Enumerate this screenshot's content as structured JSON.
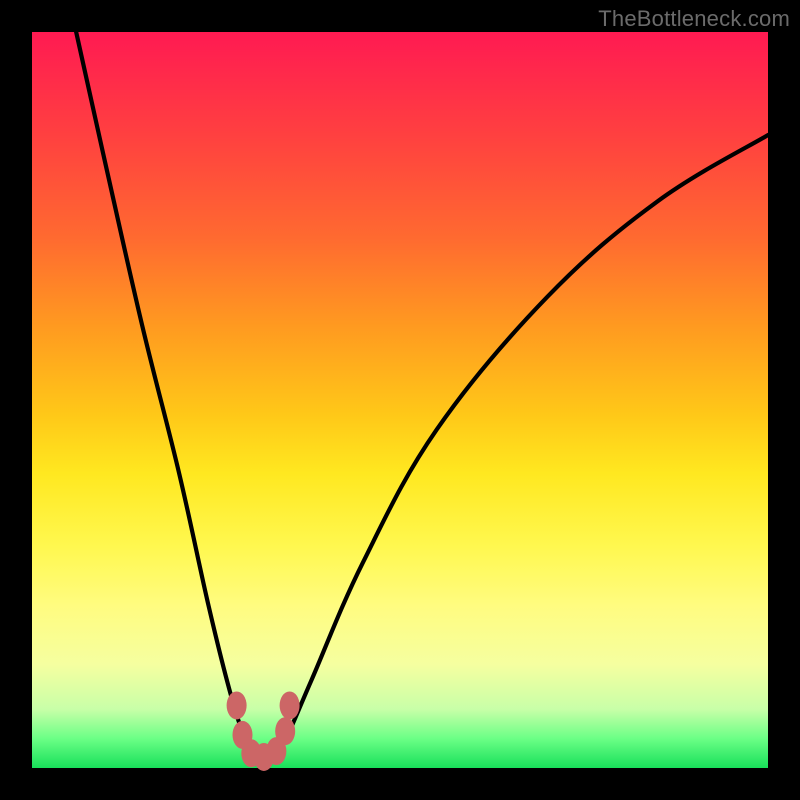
{
  "watermark": {
    "text": "TheBottleneck.com"
  },
  "colors": {
    "background": "#000000",
    "curve_stroke": "#000000",
    "marker_fill": "#cc6666",
    "gradient_top": "#ff1a52",
    "gradient_bottom": "#18e05a"
  },
  "chart_data": {
    "type": "line",
    "title": "",
    "xlabel": "",
    "ylabel": "",
    "xlim": [
      0,
      100
    ],
    "ylim": [
      0,
      100
    ],
    "grid": false,
    "legend": false,
    "series": [
      {
        "name": "bottleneck-curve",
        "x": [
          6,
          10,
          15,
          20,
          24,
          27,
          29,
          31,
          32.5,
          34.5,
          38,
          45,
          55,
          70,
          85,
          100
        ],
        "y": [
          100,
          82,
          60,
          40,
          22,
          10,
          4,
          1,
          1,
          4,
          12,
          28,
          46,
          64,
          77,
          86
        ]
      }
    ],
    "markers": [
      {
        "name": "left-cluster-top",
        "x": 27.8,
        "y": 8.5
      },
      {
        "name": "left-cluster-mid",
        "x": 28.6,
        "y": 4.5
      },
      {
        "name": "lobe-bottom-left",
        "x": 29.8,
        "y": 2.0
      },
      {
        "name": "lobe-bottom-mid",
        "x": 31.5,
        "y": 1.5
      },
      {
        "name": "lobe-bottom-right",
        "x": 33.2,
        "y": 2.3
      },
      {
        "name": "right-cluster-low",
        "x": 34.4,
        "y": 5.0
      },
      {
        "name": "right-cluster-top",
        "x": 35.0,
        "y": 8.5
      }
    ]
  }
}
